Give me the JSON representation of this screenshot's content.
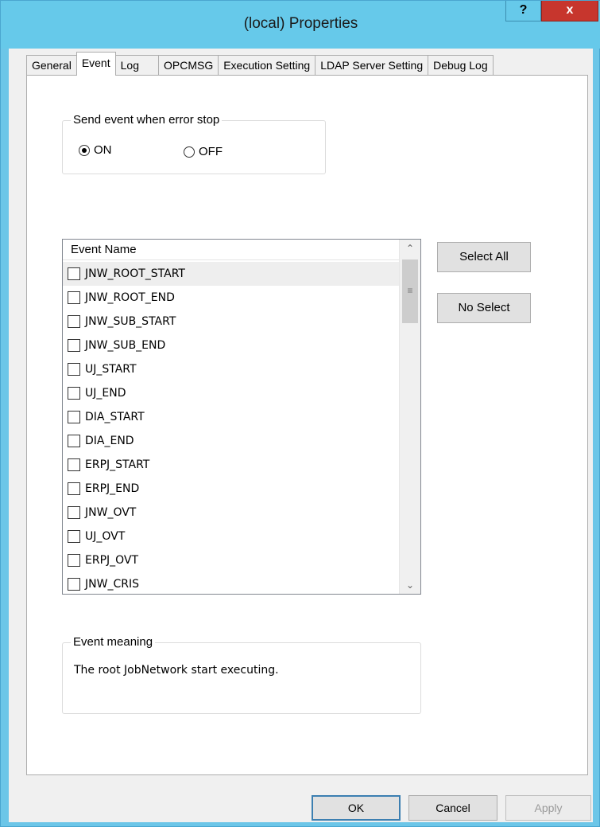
{
  "window": {
    "title": "(local) Properties",
    "help_label": "?",
    "close_label": "x"
  },
  "tabs": [
    {
      "label": "General"
    },
    {
      "label": "Event"
    },
    {
      "label": "Log"
    },
    {
      "label": "OPCMSG"
    },
    {
      "label": "Execution Setting"
    },
    {
      "label": "LDAP Server Setting"
    },
    {
      "label": "Debug Log"
    }
  ],
  "active_tab": "Event",
  "send_event": {
    "legend": "Send event when error stop",
    "on_label": "ON",
    "off_label": "OFF",
    "selected": "ON"
  },
  "event_list": {
    "header": "Event Name",
    "items": [
      {
        "label": "JNW_ROOT_START",
        "checked": false
      },
      {
        "label": "JNW_ROOT_END",
        "checked": false
      },
      {
        "label": "JNW_SUB_START",
        "checked": false
      },
      {
        "label": "JNW_SUB_END",
        "checked": false
      },
      {
        "label": "UJ_START",
        "checked": false
      },
      {
        "label": "UJ_END",
        "checked": false
      },
      {
        "label": "DIA_START",
        "checked": false
      },
      {
        "label": "DIA_END",
        "checked": false
      },
      {
        "label": "ERPJ_START",
        "checked": false
      },
      {
        "label": "ERPJ_END",
        "checked": false
      },
      {
        "label": "JNW_OVT",
        "checked": false
      },
      {
        "label": "UJ_OVT",
        "checked": false
      },
      {
        "label": "ERPJ_OVT",
        "checked": false
      },
      {
        "label": "JNW_CRIS",
        "checked": false
      }
    ]
  },
  "select_all_label": "Select All",
  "no_select_label": "No Select",
  "event_meaning": {
    "legend": "Event meaning",
    "text": "The root JobNetwork start executing."
  },
  "footer": {
    "ok_label": "OK",
    "cancel_label": "Cancel",
    "apply_label": "Apply"
  },
  "colors": {
    "titlebar": "#66c9ea",
    "close_button": "#c7362d",
    "dialog_bg": "#f0f0f0"
  }
}
